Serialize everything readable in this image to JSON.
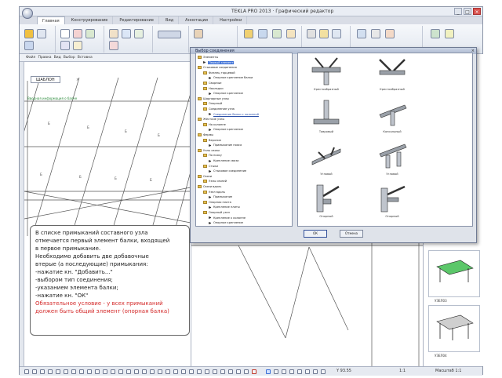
{
  "window": {
    "title": "TEKLA PRO 2013 · Графический редактор",
    "controls": [
      "_",
      "□",
      "×"
    ]
  },
  "ribbon_tabs": [
    "Главная",
    "Конструирование",
    "Редактирование",
    "Вид",
    "Аннотации",
    "Настройки"
  ],
  "toolbar2": [
    "Файл",
    "Правка",
    "Вид",
    "Выбор",
    "Вставка"
  ],
  "document_tab": {
    "label": "ШАБЛОН",
    "close": "×"
  },
  "drawing": {
    "green_label": "Вводная информация о балке"
  },
  "dialog": {
    "title": "Выбор соединения",
    "close": "×",
    "tree": [
      {
        "label": "Элементы",
        "level": 0,
        "kind": "folder"
      },
      {
        "label": "Первый элемент",
        "level": 1,
        "kind": "item",
        "selected": true
      },
      {
        "label": "Стыковые соединения",
        "level": 0,
        "kind": "folder"
      },
      {
        "label": "Фланец торцевой",
        "level": 1,
        "kind": "folder"
      },
      {
        "label": "Опорное крепление балки",
        "level": 2,
        "kind": "item"
      },
      {
        "label": "Сварные",
        "level": 1,
        "kind": "folder"
      },
      {
        "label": "Накладки",
        "level": 1,
        "kind": "folder"
      },
      {
        "label": "Опорное крепление",
        "level": 2,
        "kind": "item"
      },
      {
        "label": "Шарнирные узлы",
        "level": 0,
        "kind": "folder"
      },
      {
        "label": "Опорный",
        "level": 1,
        "kind": "folder"
      },
      {
        "label": "Соединение узла",
        "level": 1,
        "kind": "folder"
      },
      {
        "label": "Соединение балки с колонной",
        "level": 2,
        "kind": "item",
        "link": true
      },
      {
        "label": "Жёсткие узлы",
        "level": 0,
        "kind": "folder"
      },
      {
        "label": "На колонне",
        "level": 1,
        "kind": "folder"
      },
      {
        "label": "Опорное крепление",
        "level": 2,
        "kind": "item"
      },
      {
        "label": "Фермы",
        "level": 0,
        "kind": "folder"
      },
      {
        "label": "Верхние",
        "level": 1,
        "kind": "folder"
      },
      {
        "label": "Примыкание пояса",
        "level": 2,
        "kind": "item"
      },
      {
        "label": "Узлы связи",
        "level": 0,
        "kind": "folder"
      },
      {
        "label": "По поясу",
        "level": 1,
        "kind": "folder"
      },
      {
        "label": "Крепление связи",
        "level": 2,
        "kind": "item"
      },
      {
        "label": "Стыки",
        "level": 1,
        "kind": "folder"
      },
      {
        "label": "Стыковое соединение",
        "level": 2,
        "kind": "item"
      },
      {
        "label": "Связи",
        "level": 0,
        "kind": "folder"
      },
      {
        "label": "Узлы связей",
        "level": 1,
        "kind": "folder"
      },
      {
        "label": "Связи вдоль",
        "level": 0,
        "kind": "folder"
      },
      {
        "label": "Узел вдоль",
        "level": 1,
        "kind": "folder"
      },
      {
        "label": "Примыкание",
        "level": 2,
        "kind": "item"
      },
      {
        "label": "Опорная плита",
        "level": 1,
        "kind": "folder"
      },
      {
        "label": "Крепление плиты",
        "level": 2,
        "kind": "item"
      },
      {
        "label": "Опорный узел",
        "level": 1,
        "kind": "folder"
      },
      {
        "label": "Крепление к колонне",
        "level": 2,
        "kind": "item"
      },
      {
        "label": "Опорное крепление",
        "level": 2,
        "kind": "item"
      }
    ],
    "gallery": [
      {
        "label": "Крестообразный"
      },
      {
        "label": "Крестообразный"
      },
      {
        "label": "Тавровый"
      },
      {
        "label": "Консольный"
      },
      {
        "label": "Угловой"
      },
      {
        "label": "Угловой"
      },
      {
        "label": "Опорный"
      },
      {
        "label": "Опорный"
      }
    ],
    "ok_label": "ОК",
    "cancel_label": "Отмена"
  },
  "note": {
    "lines": [
      "В списке примыканий составного узла",
      "отмечается первый элемент балки, входящей",
      "в первое примыкание.",
      "Необходимо добавить две добавочные",
      "втерые (а последующие) примыкания:",
      "-нажатие кн. \"Добавить...\"",
      "-выбором тип соединения;",
      "-указанием элемента балки;",
      "-нажатие кн. \"ОК\""
    ],
    "red_lines": [
      "Обязательное условие - у всех примыканий",
      "должен быть общий элемент (опорная балка)"
    ]
  },
  "right_panel": {
    "items": [
      {
        "label": "УЗЕЛ03"
      },
      {
        "label": "УЗЕЛ04"
      }
    ]
  },
  "status": {
    "coord": "Y 93.55",
    "zoom": "1:1",
    "scale": "Масштаб 1:1"
  },
  "colors": {
    "selection": "#3b6fd6",
    "note_red": "#d42a2a",
    "accent_green": "#2a8a3a"
  }
}
